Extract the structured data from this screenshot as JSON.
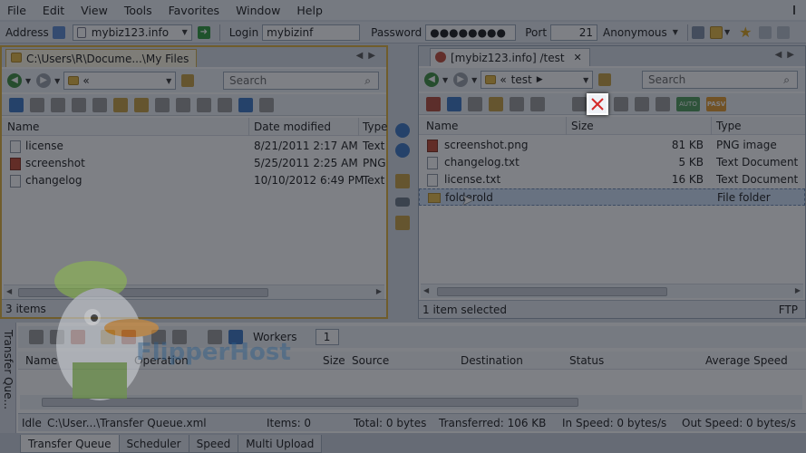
{
  "menu": [
    "File",
    "Edit",
    "View",
    "Tools",
    "Favorites",
    "Window",
    "Help"
  ],
  "connection": {
    "address_label": "Address",
    "address_value": "mybiz123.info",
    "login_label": "Login",
    "login_value": "mybizinf",
    "password_label": "Password",
    "password_value": "●●●●●●●●",
    "port_label": "Port",
    "port_value": "21",
    "anonymous_label": "Anonymous"
  },
  "left_pane": {
    "tab_title": "C:\\Users\\R\\Docume...\\My Files",
    "path": "«",
    "search_placeholder": "Search",
    "columns": [
      "Name",
      "Date modified",
      "Type"
    ],
    "files": [
      {
        "name": "license",
        "date": "8/21/2011 2:17 AM",
        "type": "Text",
        "icon": "text-file-icon"
      },
      {
        "name": "screenshot",
        "date": "5/25/2011 2:25 AM",
        "type": "PNG",
        "icon": "image-file-icon"
      },
      {
        "name": "changelog",
        "date": "10/10/2012 6:49 PM",
        "type": "Text",
        "icon": "text-file-icon"
      }
    ],
    "status": "3 items"
  },
  "right_pane": {
    "tab_title": "[mybiz123.info] /test",
    "path_prefix": "«",
    "path": "test",
    "search_placeholder": "Search",
    "columns": [
      "Name",
      "Size",
      "Type"
    ],
    "files": [
      {
        "name": "screenshot.png",
        "size": "81 KB",
        "type": "PNG image",
        "icon": "image-file-icon"
      },
      {
        "name": "changelog.txt",
        "size": "5 KB",
        "type": "Text Document",
        "icon": "text-file-icon"
      },
      {
        "name": "license.txt",
        "size": "16 KB",
        "type": "Text Document",
        "icon": "text-file-icon"
      },
      {
        "name": "folderold",
        "size": "",
        "type": "File folder",
        "icon": "folder-icon"
      }
    ],
    "status": "1 item selected",
    "protocol": "FTP",
    "pasv_label": "PASV",
    "auto_label": "AUTO"
  },
  "queue": {
    "side_title": "Transfer Que...",
    "workers_label": "Workers",
    "workers_value": "1",
    "columns": [
      "Name",
      "Operation",
      "Size",
      "Source",
      "Destination",
      "Status",
      "Average Speed"
    ],
    "status": {
      "state": "Idle",
      "file": "C:\\User...\\Transfer Queue.xml",
      "items": "Items: 0",
      "total": "Total: 0 bytes",
      "transferred": "Transferred: 106 KB",
      "in_speed": "In Speed: 0 bytes/s",
      "out_speed": "Out Speed: 0 bytes/s"
    }
  },
  "bottom_tabs": [
    "Transfer Queue",
    "Scheduler",
    "Speed",
    "Multi Upload"
  ],
  "watermark": "FlipperHost"
}
